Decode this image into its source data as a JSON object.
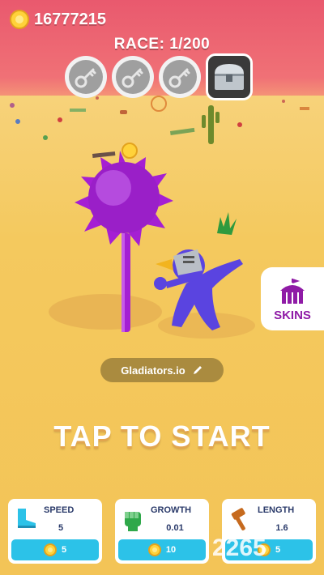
{
  "hud": {
    "coins": "16777215",
    "race": "RACE: 1/200"
  },
  "progress": {
    "key_slots": [
      "key-icon",
      "key-icon",
      "key-icon"
    ],
    "reward": "chest-icon"
  },
  "player": {
    "name": "Gladiators.io"
  },
  "cta": {
    "tap_to_start": "TAP TO START"
  },
  "skins": {
    "label": "SKINS"
  },
  "upgrades": [
    {
      "title": "SPEED",
      "level": "5",
      "cost": "5",
      "icon": "boot-icon"
    },
    {
      "title": "GROWTH",
      "level": "0.01",
      "cost": "10",
      "icon": "fist-icon"
    },
    {
      "title": "LENGTH",
      "level": "1.6",
      "cost": "5",
      "icon": "hammer-icon"
    }
  ],
  "watermark": "2265",
  "colors": {
    "sky": "#ef6474",
    "ground": "#f4c95e",
    "button": "#2cc2e8",
    "skins": "#8f1ba6",
    "mace": "#a51fd3",
    "player": "#5a44e0"
  }
}
